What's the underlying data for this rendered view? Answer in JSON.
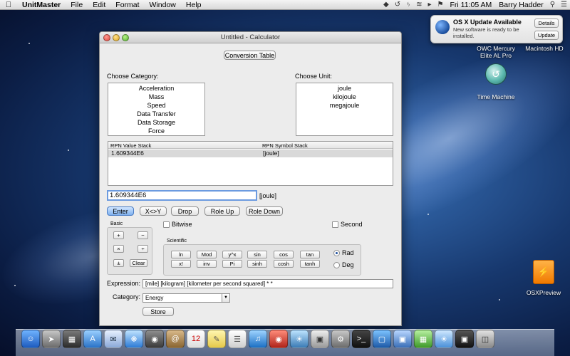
{
  "menubar": {
    "app_name": "UnitMaster",
    "menus": [
      "File",
      "Edit",
      "Format",
      "Window",
      "Help"
    ],
    "clock": "Fri 11:05 AM",
    "user": "Barry Hadder"
  },
  "notification": {
    "title": "OS X Update Available",
    "body": "New software is ready to be installed.",
    "details_label": "Details",
    "update_label": "Update"
  },
  "desktop": {
    "drive1_label": "OWC Mercury Elite AL Pro",
    "drive2_label": "Macintosh HD",
    "time_machine_label": "Time Machine",
    "osx_preview_label": "OSXPreview"
  },
  "window": {
    "title": "Untitled - Calculator",
    "conversion_table_label": "Conversion Table",
    "choose_category_label": "Choose Category:",
    "choose_unit_label": "Choose Unit:",
    "categories": [
      "Acceleration",
      "Mass",
      "Speed",
      "Data Transfer",
      "Data Storage",
      "Force"
    ],
    "units": [
      "joule",
      "kilojoule",
      "megajoule"
    ],
    "stack": {
      "value_header": "RPN Value Stack",
      "symbol_header": "RPN Symbol Stack",
      "rows": [
        {
          "value": "1.609344E6",
          "symbol": "[joule]"
        }
      ]
    },
    "input_value": "1.609344E6",
    "input_unit": "[joule]",
    "stack_buttons": [
      "Enter",
      "X<>Y",
      "Drop",
      "Role Up",
      "Role Down"
    ],
    "bitwise_label": "Bitwise",
    "second_label": "Second",
    "basic": {
      "title": "Basic",
      "buttons": [
        "+",
        "−",
        "×",
        "÷",
        "±",
        "Clear"
      ]
    },
    "scientific": {
      "title": "Scientific",
      "buttons": [
        "ln",
        "Mod",
        "y^x",
        "sin",
        "cos",
        "tan",
        "x!",
        "inv",
        "Pi",
        "sinh",
        "cosh",
        "tanh"
      ],
      "rad_label": "Rad",
      "deg_label": "Deg",
      "angle_mode": "Rad"
    },
    "expression_label": "Expression:",
    "expression_value": "[mile] [kilogram] [kilometer per second squared] * *",
    "category_label": "Category:",
    "category_value": "Energy",
    "store_label": "Store"
  },
  "dock": {
    "icons": [
      "finder-icon",
      "launchpad-icon",
      "mission-control-icon",
      "app-store-icon",
      "mail-icon",
      "safari-icon",
      "facetime-icon",
      "contacts-icon",
      "calendar-icon",
      "notes-icon",
      "reminders-icon",
      "itunes-icon",
      "photo-booth-icon",
      "iphoto-icon",
      "preview-icon",
      "system-preferences-icon",
      "terminal-icon",
      "virtualbox-icon",
      "keynote-icon",
      "numbers-icon",
      "messages-icon",
      "photo-icon",
      "trash-icon"
    ]
  },
  "colors": {
    "accent": "#6c9be0",
    "default_button": "#7fb1ef"
  }
}
